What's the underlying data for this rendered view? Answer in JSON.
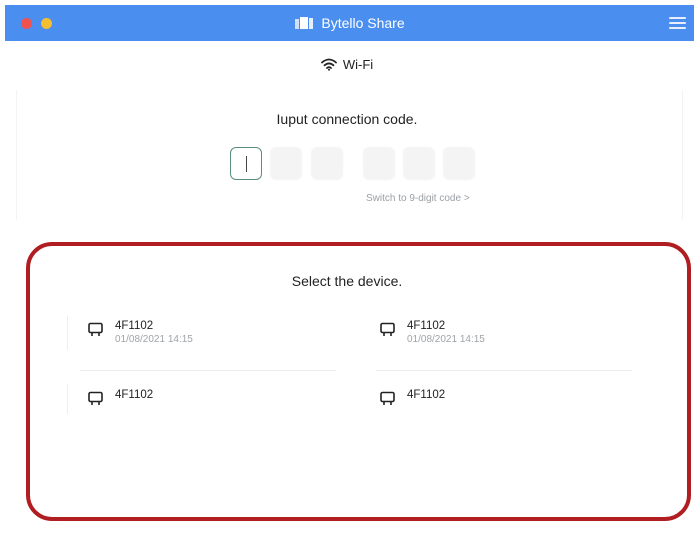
{
  "window": {
    "title": "Bytello Share",
    "accent_color": "#4a8ff0",
    "controls": [
      "close",
      "minimize"
    ],
    "menu_icon": "hamburger-menu-icon"
  },
  "network": {
    "icon": "wifi-icon",
    "label": "Wi-Fi"
  },
  "connection_code": {
    "title": "Iuput connection code.",
    "digits": [
      "",
      "",
      "",
      "",
      "",
      ""
    ],
    "switch_link": "Switch to 9-digit code >"
  },
  "devices": {
    "title": "Select the device.",
    "highlight_color": "#b01e22",
    "items": [
      {
        "name": "4F1102",
        "time": "01/08/2021 14:15",
        "icon": "monitor-icon"
      },
      {
        "name": "4F1102",
        "time": "01/08/2021 14:15",
        "icon": "monitor-icon"
      },
      {
        "name": "4F1102",
        "time": "",
        "icon": "monitor-icon"
      },
      {
        "name": "4F1102",
        "time": "",
        "icon": "monitor-icon"
      }
    ]
  }
}
